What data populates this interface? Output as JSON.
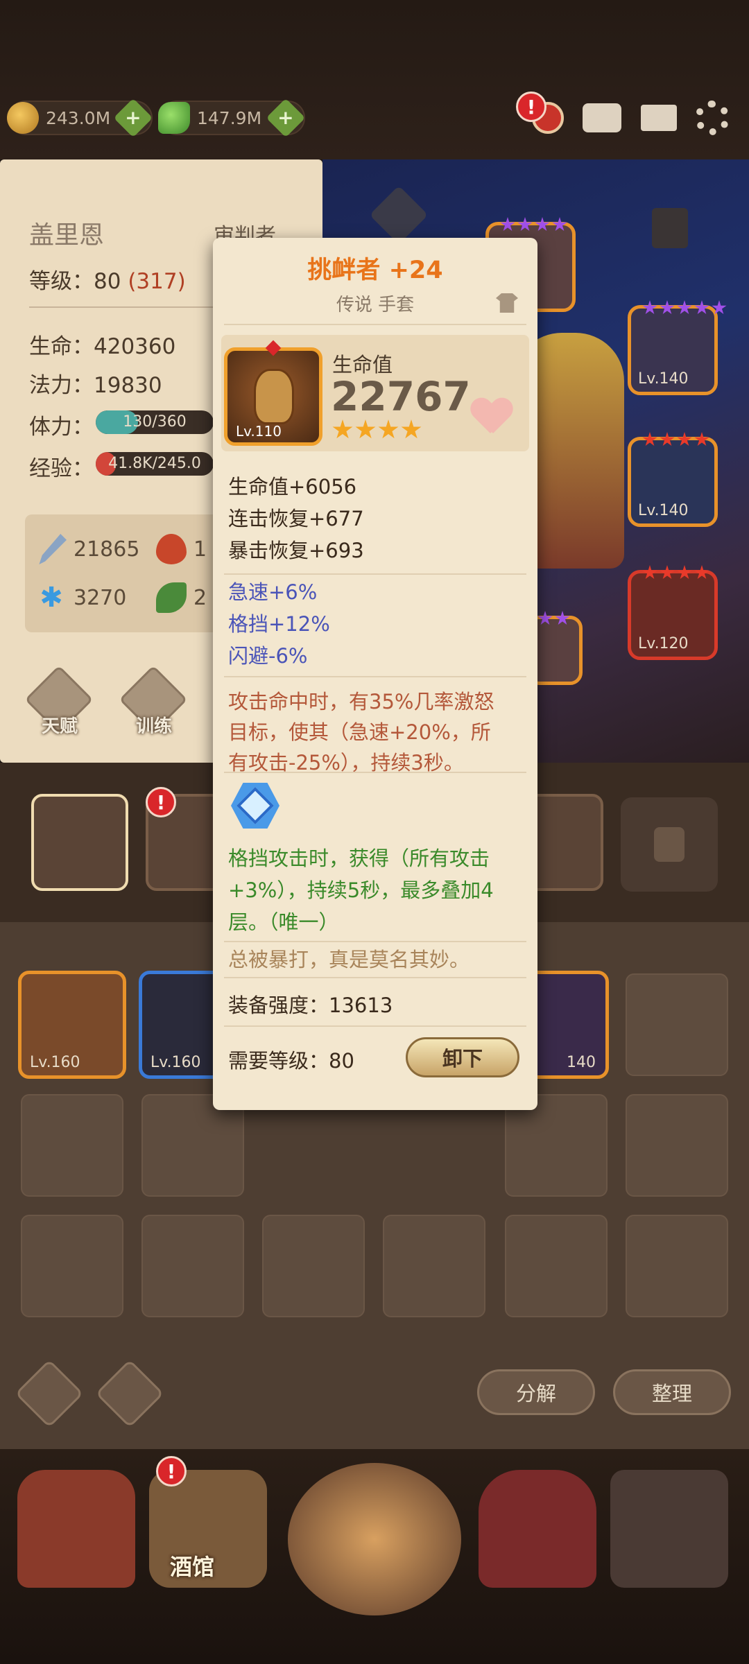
{
  "currencies": [
    {
      "name": "gold",
      "value": "243.0M"
    },
    {
      "name": "gems",
      "value": "147.9M"
    }
  ],
  "hero": {
    "name": "盖里恩",
    "class": "审判者",
    "level_label": "等级：",
    "level": "80",
    "level_extra": "(317)",
    "hp_label": "生命：",
    "hp": "420360",
    "mp_label": "法力：",
    "mp": "19830",
    "stamina_label": "体力：",
    "stamina": "130/360",
    "stamina_fraction": 0.36,
    "exp_label": "经验：",
    "exp": "41.8K/245.0",
    "exp_fraction": 0.17,
    "attrs": [
      {
        "icon": "sword-icon",
        "value": "21865"
      },
      {
        "icon": "fire-icon",
        "value": "1"
      },
      {
        "icon": "snowflake-icon",
        "value": "3270"
      },
      {
        "icon": "leaf-icon",
        "value": "2"
      }
    ],
    "buttons": {
      "talent": "天赋",
      "training": "训练"
    }
  },
  "equipped_slots": [
    {
      "level": "Lv.140",
      "stars": 5
    },
    {
      "level": "Lv.140",
      "stars": 4
    },
    {
      "level": "Lv.120",
      "stars": 4
    }
  ],
  "inventory": {
    "items": [
      {
        "level": "Lv.160"
      },
      {
        "level": "Lv.160"
      },
      {
        "level": "140"
      }
    ],
    "actions": {
      "decompose": "分解",
      "sort": "整理"
    }
  },
  "nav": {
    "tavern": "酒馆"
  },
  "tooltip": {
    "title": "挑衅者 +24",
    "subtitle": "传说 手套",
    "item_level": "Lv.110",
    "main_stat_label": "生命值",
    "main_stat_value": "22767",
    "rating_stars": 4,
    "base_stats": [
      "生命值+6056",
      "连击恢复+677",
      "暴击恢复+693"
    ],
    "bonus_stats": [
      "急速+6%",
      "格挡+12%",
      "闪避-6%"
    ],
    "effect_lines": [
      "攻击命中时，有35%几率激怒",
      "目标，使其（急速+20%，所",
      "有攻击-25%），持续3秒。"
    ],
    "set_lines": [
      "格挡攻击时，获得（所有攻击",
      "+3%），持续5秒，最多叠加4",
      "层。（唯一）"
    ],
    "flavor": "总被暴打，真是莫名其妙。",
    "power_label": "装备强度：",
    "power_value": "13613",
    "req_label": "需要等级：",
    "req_value": "80",
    "unequip_label": "卸下"
  },
  "colors": {
    "title": "#e8741a",
    "blue_stat": "#4a54b8",
    "effect": "#b4583a",
    "set_bonus": "#3a8a2a",
    "rarity_border": "#f0a02c"
  }
}
